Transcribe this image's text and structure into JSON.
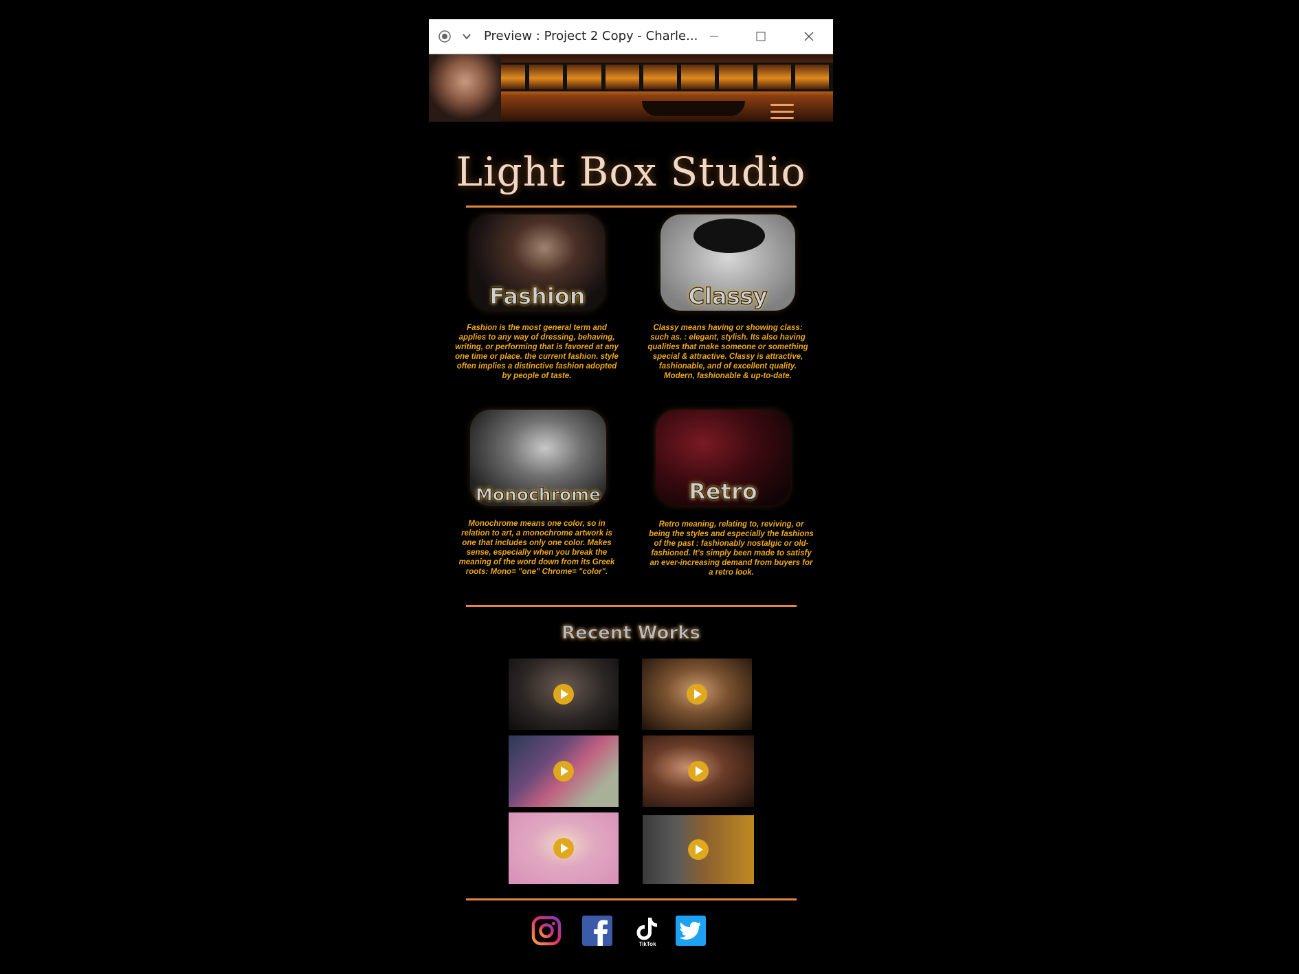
{
  "window": {
    "title": "Preview : Project 2 Copy - Charle..."
  },
  "site": {
    "brand": "Light Box Studio"
  },
  "categories": [
    {
      "label": "Fashion",
      "description": "Fashion is the most general term and applies to any way of dressing, behaving, writing, or performing that is favored at any one time or place. the current fashion. style often implies a distinctive fashion adopted by people of taste."
    },
    {
      "label": "Classy",
      "description": "Classy means having or showing class: such as. : elegant, stylish. Its also having qualities that make someone or something special & attractive. Classy is attractive, fashionable, and of excellent quality. Modern, fashionable & up-to-date."
    },
    {
      "label": "Monochrome",
      "description": "Monochrome means one color, so in relation to art, a monochrome artwork is one that includes only one color. Makes sense, especially when you break the meaning of the word down from its Greek roots: Mono= \"one\" Chrome= \"color\"."
    },
    {
      "label": "Retro",
      "description": "Retro meaning, relating to, reviving, or being the styles and especially the fashions of the past : fashionably nostalgic or old-fashioned. It's simply been made to satisfy an ever-increasing demand from buyers for a retro look."
    }
  ],
  "recent_works": {
    "heading": "Recent Works"
  },
  "social": {
    "tiktok_label": "TikTok"
  },
  "colors": {
    "accent": "#e8873a",
    "text_gold": "#f0a818",
    "background": "#000000"
  }
}
